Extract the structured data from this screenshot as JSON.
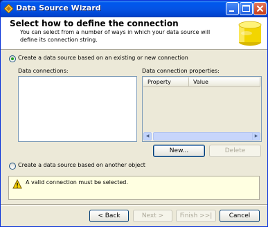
{
  "window": {
    "title": "Data Source Wizard"
  },
  "header": {
    "title": "Select how to define the connection",
    "description": "You can select from a number of ways in which your data source will define its connection string."
  },
  "options": {
    "existing_label": "Create a data source based on an existing or new connection",
    "existing_selected": true,
    "other_label": "Create a data source based on another object",
    "other_selected": false
  },
  "connections": {
    "label": "Data connections:",
    "items": []
  },
  "properties": {
    "label": "Data connection properties:",
    "columns": [
      "Property",
      "Value"
    ]
  },
  "buttons": {
    "new": "New...",
    "delete": "Delete",
    "back": "< Back",
    "next": "Next >",
    "finish": "Finish >>|",
    "cancel": "Cancel"
  },
  "message": "A valid connection must be selected."
}
